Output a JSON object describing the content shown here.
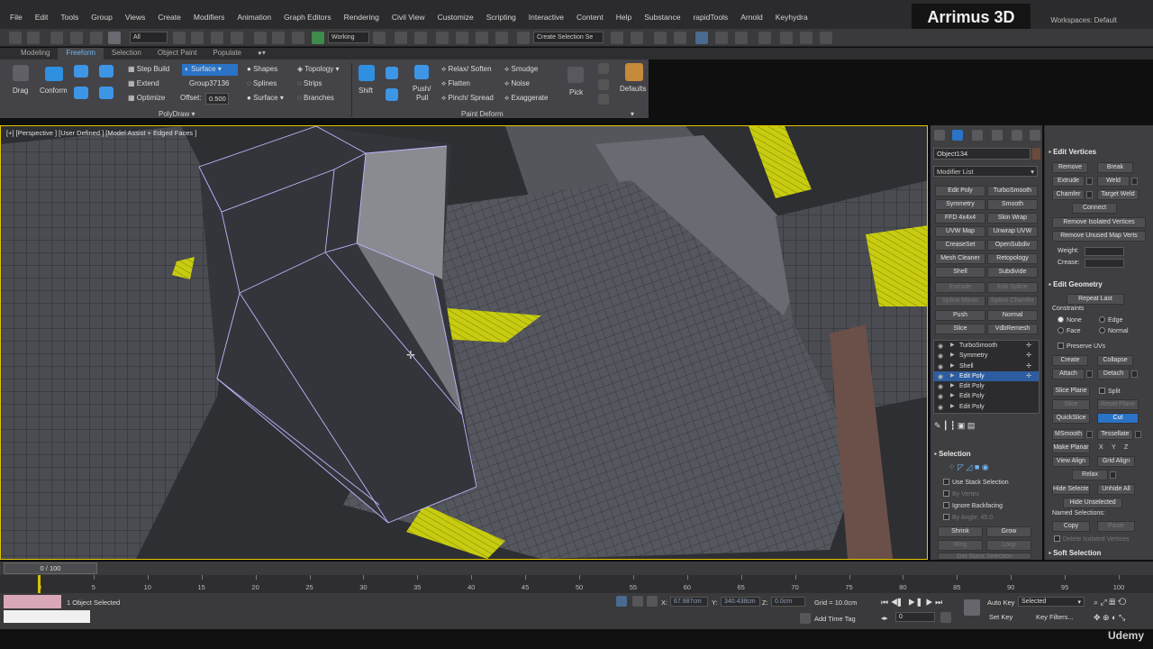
{
  "menu": {
    "items": [
      "File",
      "Edit",
      "Tools",
      "Group",
      "Views",
      "Create",
      "Modifiers",
      "Animation",
      "Graph Editors",
      "Rendering",
      "Civil View",
      "Customize",
      "Scripting",
      "Interactive",
      "Content",
      "Help",
      "Substance",
      "rapidTools",
      "Arnold",
      "Keyhydra"
    ],
    "brand": "Arrimus 3D",
    "workspace_label": "Workspaces: Default"
  },
  "toolbar": {
    "filter": "All",
    "refcoord": "Working",
    "selset": "Create Selection Se"
  },
  "ribbon": {
    "tabs": [
      "Modeling",
      "Freeform",
      "Selection",
      "Object Paint",
      "Populate"
    ],
    "active_tab": "Freeform",
    "drag": "Drag",
    "conform": "Conform",
    "step_build": "Step Build",
    "extend": "Extend",
    "optimize": "Optimize",
    "surface_btn": "Surface",
    "group_name": "Group37136",
    "offset_label": "Offset:",
    "offset_value": "0.500",
    "shapes": "Shapes",
    "splines": "Splines",
    "surface2": "Surface",
    "topology": "Topology",
    "strips": "Strips",
    "branches": "Branches",
    "shift": "Shift",
    "push_pull_1": "Push/",
    "push_pull_2": "Pull",
    "relax_soften": "Relax/ Soften",
    "flatten": "Flatten",
    "pinch_spread": "Pinch/ Spread",
    "smudge": "Smudge",
    "noise": "Noise",
    "exaggerate": "Exaggerate",
    "pick": "Pick",
    "defaults": "Defaults",
    "panel_polydraw": "PolyDraw",
    "panel_paintdeform": "Paint Deform"
  },
  "viewport": {
    "label": "[+] [Perspective ] [User Defined ] [Model Assist + Edged Faces ]"
  },
  "command_panel": {
    "object_name": "Object134",
    "modifier_list": "Modifier List",
    "buttons": [
      [
        "Edit Poly",
        "TurboSmooth"
      ],
      [
        "Symmetry",
        "Smooth"
      ],
      [
        "FFD 4x4x4",
        "Skin Wrap"
      ],
      [
        "UVW Map",
        "Unwrap UVW"
      ],
      [
        "CreaseSet",
        "OpenSubdiv"
      ],
      [
        "Mesh Cleaner",
        "Retopology"
      ],
      [
        "Shell",
        "Subdivide"
      ],
      [
        "Extrude",
        "Edit Spline"
      ],
      [
        "Spline Mirror",
        "Spline Chamfer"
      ],
      [
        "Push",
        "Normal"
      ],
      [
        "Slice",
        "VdbRemesh"
      ]
    ],
    "dim_rows": [
      7,
      8
    ],
    "stack": [
      "TurboSmooth",
      "Symmetry",
      "Shell",
      "Edit Poly",
      "Edit Poly",
      "Edit Poly",
      "Edit Poly"
    ],
    "stack_selected": 3,
    "selection": {
      "title": "Selection",
      "use_stack": "Use Stack Selection",
      "by_vertex": "By Vertex",
      "ignore_backfacing": "Ignore Backfacing",
      "by_angle": "By Angle:",
      "by_angle_value": "45.0",
      "shrink": "Shrink",
      "grow": "Grow",
      "ring": "Ring",
      "loop": "Loop",
      "get_stack": "Get Stack Selection"
    }
  },
  "params": {
    "edit_vertices": "Edit Vertices",
    "remove": "Remove",
    "break": "Break",
    "extrude": "Extrude",
    "weld": "Weld",
    "chamfer": "Chamfer",
    "target_weld": "Target Weld",
    "connect": "Connect",
    "remove_isolated": "Remove Isolated Vertices",
    "remove_unused": "Remove Unused Map Verts",
    "weight": "Weight:",
    "crease": "Crease:",
    "edit_geometry": "Edit Geometry",
    "repeat_last": "Repeat Last",
    "constraints": "Constraints",
    "c_none": "None",
    "c_edge": "Edge",
    "c_face": "Face",
    "c_normal": "Normal",
    "preserve_uvs": "Preserve UVs",
    "create": "Create",
    "collapse": "Collapse",
    "attach": "Attach",
    "detach": "Detach",
    "slice_plane": "Slice Plane",
    "split": "Split",
    "slice": "Slice",
    "reset_plane": "Reset Plane",
    "quickslice": "QuickSlice",
    "cut": "Cut",
    "msmooth": "MSmooth",
    "tessellate": "Tessellate",
    "make_planar": "Make Planar",
    "x": "X",
    "y": "Y",
    "z": "Z",
    "view_align": "View Align",
    "grid_align": "Grid Align",
    "relax": "Relax",
    "hide_selected": "Hide Selected",
    "unhide_all": "Unhide All",
    "hide_unselected": "Hide Unselected",
    "named_selections": "Named Selections:",
    "copy": "Copy",
    "paste": "Paste",
    "delete_isolated": "Delete Isolated Vertices",
    "soft_selection": "Soft Selection"
  },
  "timeline": {
    "frame": "0 / 100",
    "ticks": [
      "0",
      "5",
      "10",
      "15",
      "20",
      "25",
      "30",
      "35",
      "40",
      "45",
      "50",
      "55",
      "60",
      "65",
      "70",
      "75",
      "80",
      "85",
      "90",
      "95",
      "100"
    ]
  },
  "status": {
    "selected": "1 Object Selected",
    "x_label": "X:",
    "x_value": "67.987cm",
    "y_label": "Y:",
    "y_value": "340.438cm",
    "z_label": "Z:",
    "z_value": "0.0cm",
    "grid": "Grid = 10.0cm",
    "add_time_tag": "Add Time Tag",
    "auto_key": "Auto Key",
    "set_key": "Set Key",
    "key_mode": "Selected",
    "key_filters": "Key Filters...",
    "frame_field": "0",
    "udemy": "Udemy"
  },
  "colors": {
    "accent_blue": "#2a73c6",
    "viewport_border": "#e6c700",
    "wire_yellow": "#e3e800"
  }
}
